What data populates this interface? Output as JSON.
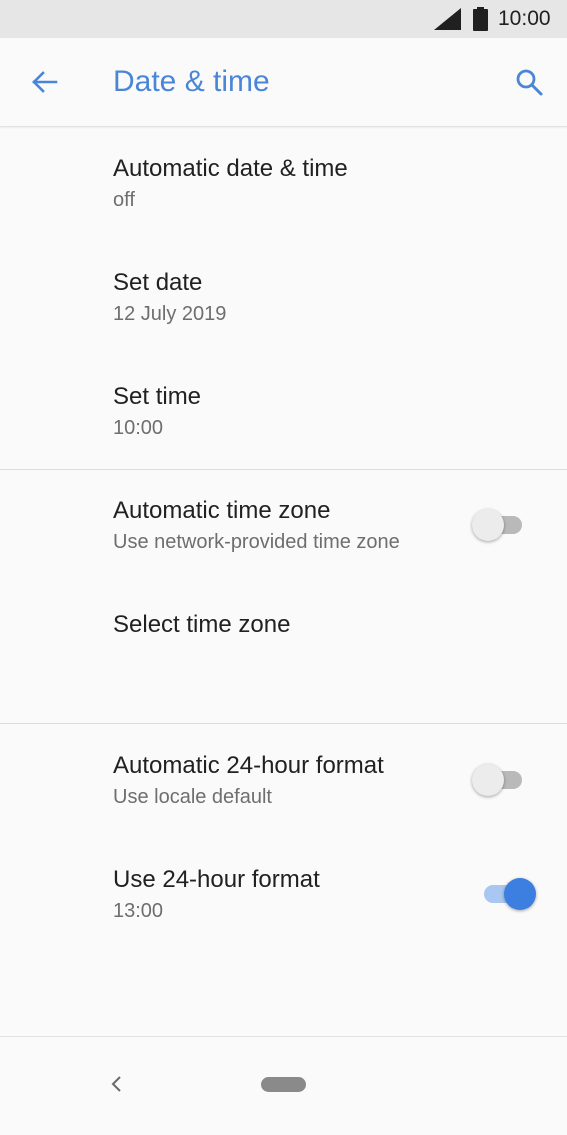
{
  "status_bar": {
    "time": "10:00",
    "icons": [
      "signal-icon",
      "battery-icon"
    ]
  },
  "app_bar": {
    "title": "Date & time",
    "back_icon": "arrow-left-icon",
    "search_icon": "search-icon",
    "accent_color": "#4a86d6"
  },
  "settings": {
    "automatic_date_time": {
      "title": "Automatic date & time",
      "summary": "off"
    },
    "set_date": {
      "title": "Set date",
      "summary": "12 July 2019"
    },
    "set_time": {
      "title": "Set time",
      "summary": "10:00"
    },
    "automatic_time_zone": {
      "title": "Automatic time zone",
      "summary": "Use network-provided time zone",
      "enabled": false
    },
    "select_time_zone": {
      "title": "Select time zone"
    },
    "automatic_24_hour": {
      "title": "Automatic 24-hour format",
      "summary": "Use locale default",
      "enabled": false
    },
    "use_24_hour": {
      "title": "Use 24-hour format",
      "summary": "13:00",
      "enabled": true
    }
  },
  "nav_bar": {
    "back_icon": "chevron-left-icon",
    "home_icon": "home-pill-icon"
  },
  "colors": {
    "toggle_on": "#3d7fe0",
    "toggle_on_track": "#a9c7f1",
    "toggle_off_thumb": "#ececec",
    "toggle_off_track": "#b9b9b9"
  }
}
